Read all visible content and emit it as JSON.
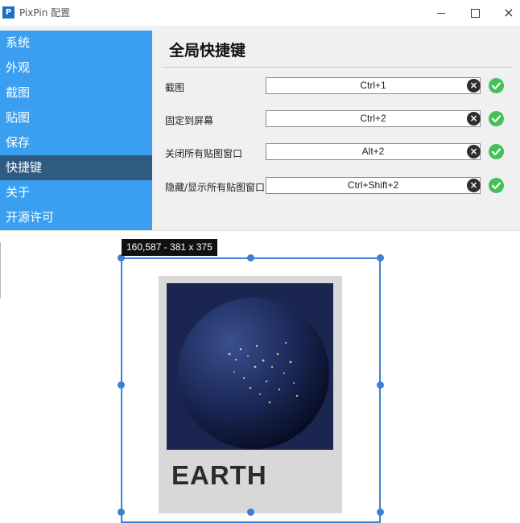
{
  "window": {
    "app_icon_letter": "P",
    "title": "PixPin 配置",
    "controls": {
      "minimize": "minimize-icon",
      "maximize": "maximize-icon",
      "close": "×"
    }
  },
  "sidebar": {
    "items": [
      {
        "label": "系统",
        "active": false
      },
      {
        "label": "外观",
        "active": false
      },
      {
        "label": "截图",
        "active": false
      },
      {
        "label": "贴图",
        "active": false
      },
      {
        "label": "保存",
        "active": false
      },
      {
        "label": "快捷键",
        "active": true
      },
      {
        "label": "关于",
        "active": false
      },
      {
        "label": "开源许可",
        "active": false
      }
    ]
  },
  "content": {
    "heading": "全局快捷键",
    "hotkeys": [
      {
        "label": "截图",
        "value": "Ctrl+1"
      },
      {
        "label": "固定到屏幕",
        "value": "Ctrl+2"
      },
      {
        "label": "关闭所有贴图窗口",
        "value": "Alt+2"
      },
      {
        "label": "隐藏/显示所有贴图窗口",
        "value": "Ctrl+Shift+2"
      }
    ],
    "clear_glyph": "×",
    "status_icon": "check-circle-icon"
  },
  "capture": {
    "info": "160,587 - 381 x 375",
    "poster_text": "EARTH"
  },
  "colors": {
    "sidebar": "#3a9ff0",
    "sidebar_active": "#2f5b83",
    "selection": "#3d7fd6",
    "ok": "#44c055"
  }
}
